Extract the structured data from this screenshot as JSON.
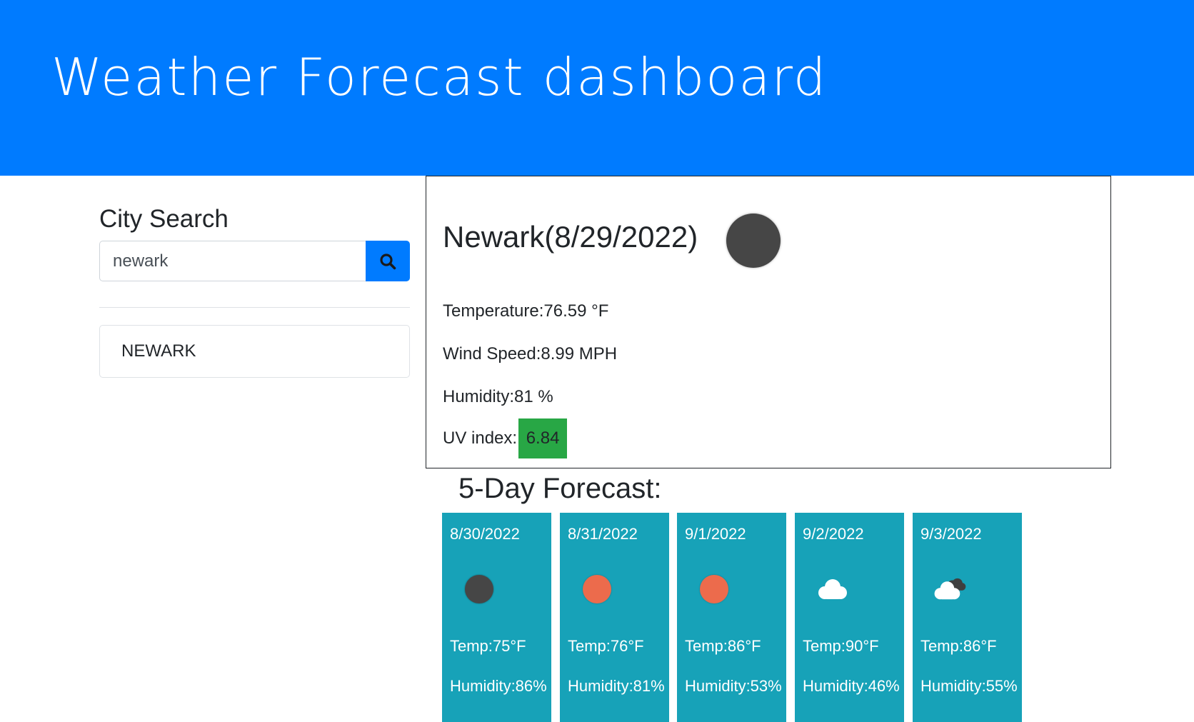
{
  "header": {
    "title": "Weather Forecast dashboard",
    "color": "#007bff"
  },
  "search": {
    "title": "City Search",
    "input_value": "newark",
    "button_icon": "search-icon"
  },
  "history": {
    "items": [
      "NEWARK"
    ]
  },
  "current": {
    "city_date": "Newark(8/29/2022)",
    "icon": "dark-circle-icon",
    "temperature": "Temperature:76.59 °F",
    "wind": "Wind Speed:8.99 MPH",
    "humidity": "Humidity:81 %",
    "uv_label": "UV index:",
    "uv_value": "6.84",
    "uv_color": "#28a745"
  },
  "forecast": {
    "title": "5-Day Forecast:",
    "card_color": "#17a2b8",
    "days": [
      {
        "date": "8/30/2022",
        "icon": "dark-circle-icon",
        "temp": "Temp:75°F",
        "humidity": "Humidity:86%"
      },
      {
        "date": "8/31/2022",
        "icon": "sun-icon",
        "temp": "Temp:76°F",
        "humidity": "Humidity:81%"
      },
      {
        "date": "9/1/2022",
        "icon": "sun-icon",
        "temp": "Temp:86°F",
        "humidity": "Humidity:53%"
      },
      {
        "date": "9/2/2022",
        "icon": "cloud-icon",
        "temp": "Temp:90°F",
        "humidity": "Humidity:46%"
      },
      {
        "date": "9/3/2022",
        "icon": "broken-clouds-icon",
        "temp": "Temp:86°F",
        "humidity": "Humidity:55%"
      }
    ]
  }
}
